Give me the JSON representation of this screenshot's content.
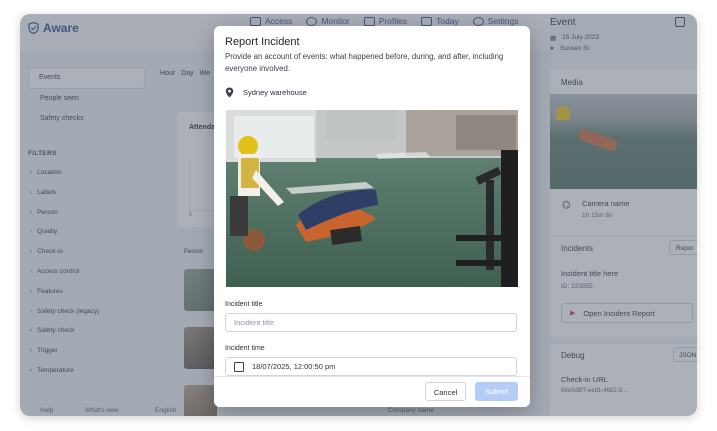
{
  "app": {
    "name": "Aware"
  },
  "nav": {
    "items": [
      {
        "label": "Access",
        "icon": "key-icon"
      },
      {
        "label": "Monitor",
        "icon": "eye-icon"
      },
      {
        "label": "Profiles",
        "icon": "id-card-icon"
      },
      {
        "label": "Today",
        "icon": "grid-icon"
      },
      {
        "label": "Settings",
        "icon": "gear-icon"
      }
    ]
  },
  "sidebar": {
    "items": [
      "Events",
      "People seen",
      "Safety checks"
    ],
    "filters_title": "FILTERS",
    "filters": [
      "Location",
      "Labels",
      "Person",
      "Quality",
      "Check-in",
      "Access control",
      "Features",
      "Safety check (legacy)",
      "Safety check",
      "Trigger",
      "Temperature"
    ]
  },
  "main": {
    "tabs": [
      "Hour",
      "Day",
      "We"
    ],
    "chart_title": "Attendance",
    "axis_ticks": [
      "5",
      "3"
    ],
    "person_label": "Person"
  },
  "bottombar": {
    "help": "Help",
    "whats_new": "What's new",
    "language": "English",
    "company": "Company name"
  },
  "event_panel": {
    "title": "Event",
    "date": "15 July 2023",
    "location": "Sussex St",
    "media_title": "Media",
    "camera_name": "Camera name",
    "camera_age": "1h 15m 8s",
    "incidents_title": "Incidents",
    "report_button": "Repor",
    "incident_title": "Incident title here",
    "incident_id": "ID: 233855",
    "open_report_button": "Open Incident Report",
    "debug_title": "Debug",
    "json_button": "JSON",
    "checkin_url_label": "Check-in URL",
    "checkin_url_value": "88e5d8f7-eed1-4682-8..."
  },
  "modal": {
    "title": "Report Incident",
    "description": "Provide an account of events: what happened before, during, and after, including everyone involved.",
    "location": "Sydney warehouse",
    "incident_title_label": "Incident title",
    "incident_title_placeholder": "Incident title",
    "incident_time_label": "Incident time",
    "incident_time_value": "18/07/2025, 12:00:50 pm",
    "cancel_label": "Cancel",
    "submit_label": "Submit"
  },
  "colors": {
    "brand": "#2d4a8a",
    "accent": "#3b82f6",
    "submit_disabled": "#b3cdf6",
    "danger": "#d23c3c"
  }
}
